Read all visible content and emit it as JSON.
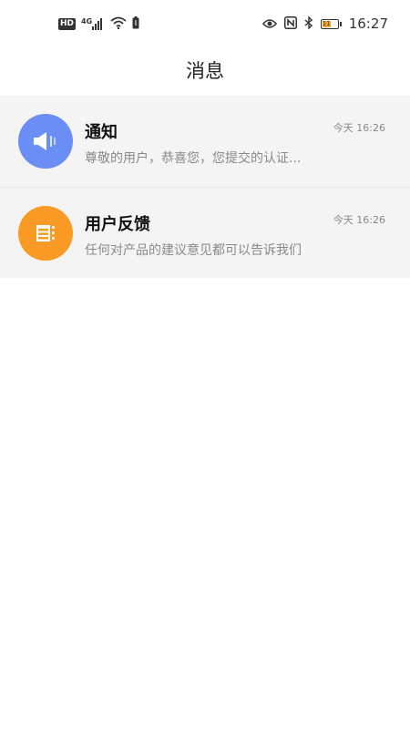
{
  "status_bar": {
    "hd": "HD",
    "network": "4G",
    "battery_level": "11",
    "time": "16:27",
    "icons": [
      "signal-icon",
      "wifi-icon",
      "battery-saver-icon",
      "eye-icon",
      "nfc-icon",
      "bluetooth-icon",
      "battery-icon"
    ]
  },
  "header": {
    "title": "消息"
  },
  "messages": [
    {
      "title": "通知",
      "time": "今天 16:26",
      "preview": "尊敬的用户，恭喜您，您提交的认证...",
      "icon": "speaker-icon",
      "color": "#6b8ef6"
    },
    {
      "title": "用户反馈",
      "time": "今天 16:26",
      "preview": "任何对产品的建议意见都可以告诉我们",
      "icon": "notebook-icon",
      "color": "#f89a24"
    }
  ]
}
